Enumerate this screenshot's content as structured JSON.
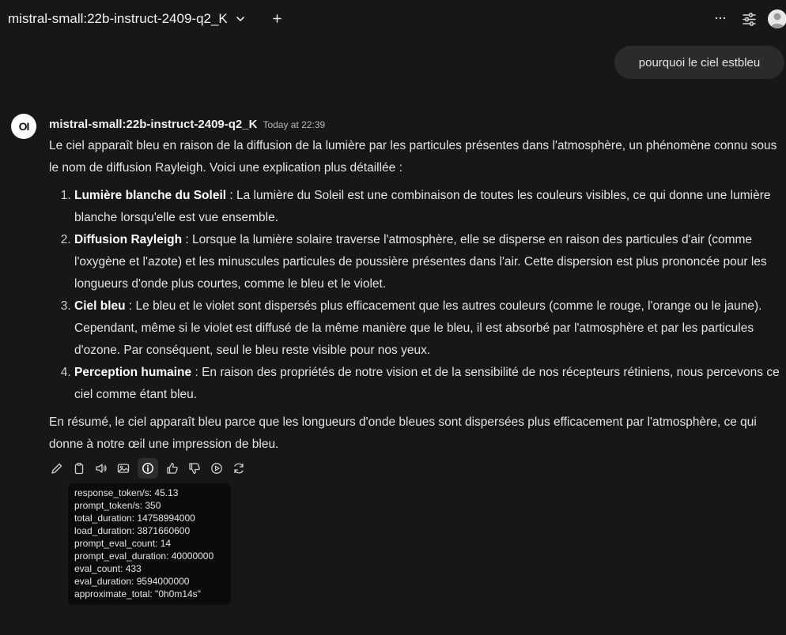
{
  "header": {
    "model_name": "mistral-small:22b-instruct-2409-q2_K",
    "icons": [
      "chevron-down-icon",
      "plus-icon",
      "more-icon",
      "sliders-icon",
      "avatar"
    ]
  },
  "user_message": "pourquoi le ciel estbleu",
  "assistant": {
    "logo_text": "OI",
    "name": "mistral-small:22b-instruct-2409-q2_K",
    "time": "Today at 22:39",
    "intro": "Le ciel apparaît bleu en raison de la diffusion de la lumière par les particules présentes dans l'atmosphère, un phénomène connu sous le nom de diffusion Rayleigh. Voici une explication plus détaillée :",
    "items": [
      {
        "title": "Lumière blanche du Soleil",
        "text": " : La lumière du Soleil est une combinaison de toutes les couleurs visibles, ce qui donne une lumière blanche lorsqu'elle est vue ensemble."
      },
      {
        "title": "Diffusion Rayleigh",
        "text": " : Lorsque la lumière solaire traverse l'atmosphère, elle se disperse en raison des particules d'air (comme l'oxygène et l'azote) et les minuscules particules de poussière présentes dans l'air. Cette dispersion est plus prononcée pour les longueurs d'onde plus courtes, comme le bleu et le violet."
      },
      {
        "title": "Ciel bleu",
        "text": " : Le bleu et le violet sont dispersés plus efficacement que les autres couleurs (comme le rouge, l'orange ou le jaune). Cependant, même si le violet est diffusé de la même manière que le bleu, il est absorbé par l'atmosphère et par les particules d'ozone. Par conséquent, seul le bleu reste visible pour nos yeux."
      },
      {
        "title": "Perception humaine",
        "text": " : En raison des propriétés de notre vision et de la sensibilité de nos récepteurs rétiniens, nous percevons ce ciel comme étant bleu."
      }
    ],
    "conclusion": "En résumé, le ciel apparaît bleu parce que les longueurs d'onde bleues sont dispersées plus efficacement par l'atmosphère, ce qui donne à notre œil une impression de bleu."
  },
  "actions": [
    "edit-icon",
    "copy-icon",
    "speaker-icon",
    "image-icon",
    "info-icon",
    "thumbs-up-icon",
    "thumbs-down-icon",
    "play-icon",
    "regenerate-icon"
  ],
  "stats": [
    "response_token/s: 45.13",
    "prompt_token/s: 350",
    "total_duration: 14758994000",
    "load_duration: 3871660600",
    "prompt_eval_count: 14",
    "prompt_eval_duration: 40000000",
    "eval_count: 433",
    "eval_duration: 9594000000",
    "approximate_total: \"0h0m14s\""
  ],
  "colors": {
    "background": "#171717",
    "user_bubble": "#2b2b2b",
    "tooltip": "#0b0b0b",
    "text": "#e3e3e3"
  }
}
